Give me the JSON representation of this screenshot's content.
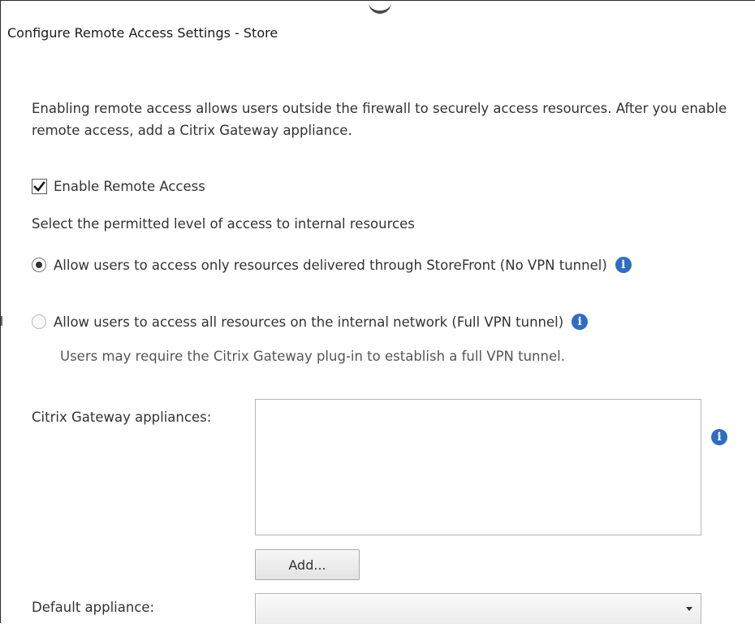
{
  "dialog": {
    "title": "Configure Remote Access Settings - Store"
  },
  "intro": {
    "text": "Enabling remote access allows users outside the firewall to securely access resources. After you enable remote access, add a Citrix Gateway appliance."
  },
  "enable_remote_access": {
    "label": "Enable Remote Access",
    "checked": true
  },
  "access_level": {
    "prompt": "Select the permitted level of access to internal resources",
    "options": [
      {
        "label": "Allow users to access only resources delivered through StoreFront (No VPN tunnel)",
        "selected": true,
        "icon": "info-icon"
      },
      {
        "label": "Allow users to access all resources on the internal network (Full VPN tunnel)",
        "selected": false,
        "icon": "info-icon",
        "note": "Users may require the Citrix Gateway plug-in to establish a full VPN tunnel."
      }
    ]
  },
  "gateway_appliances": {
    "label": "Citrix Gateway appliances:",
    "items": [],
    "icon": "info-icon",
    "add_button": "Add..."
  },
  "default_appliance": {
    "label": "Default appliance:",
    "value": ""
  },
  "colors": {
    "info_icon": "#2f6dc3",
    "text": "#333333",
    "border": "#b5b5b5"
  },
  "icons": {
    "info": "i"
  }
}
